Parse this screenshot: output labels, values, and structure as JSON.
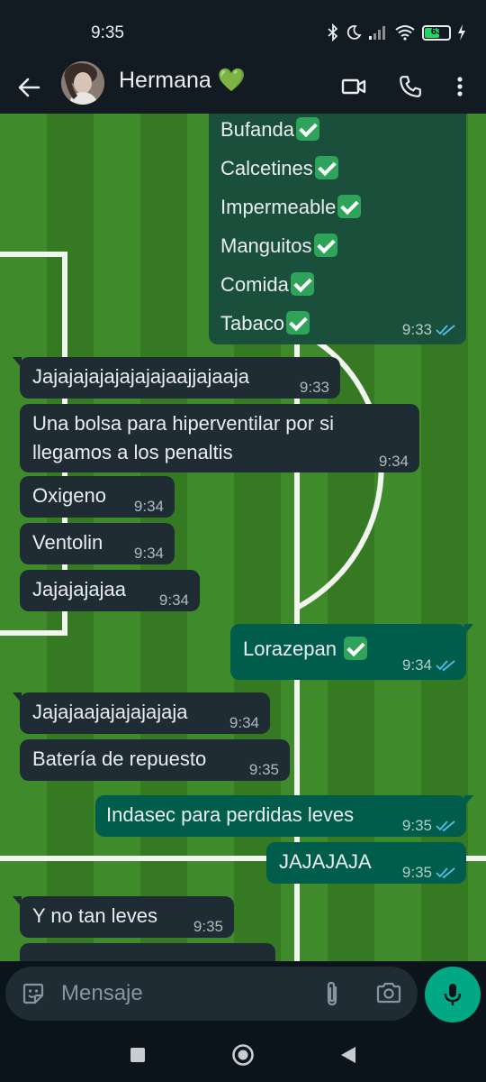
{
  "status_bar": {
    "time": "9:35",
    "battery_level": "63",
    "battery_fraction": 0.63
  },
  "header": {
    "contact_name": "Hermana 💚"
  },
  "colors": {
    "incoming_bubble": "#202c33",
    "outgoing_bubble": "#005c4b",
    "accent": "#00a884",
    "read_ticks": "#53bdeb"
  },
  "top_list": {
    "items": [
      "Bufanda",
      "Calcetines",
      "Impermeable",
      "Manguitos",
      "Comida",
      "Tabaco"
    ],
    "time": "9:33"
  },
  "messages": [
    {
      "dir": "in",
      "text": "Jajajajajajajajajaajjajaaja",
      "time": "9:33"
    },
    {
      "dir": "in",
      "text": "Una bolsa para hiperventilar por si\nllegamos a los penaltis",
      "time": "9:34"
    },
    {
      "dir": "in",
      "text": "Oxigeno",
      "time": "9:34"
    },
    {
      "dir": "in",
      "text": "Ventolin",
      "time": "9:34"
    },
    {
      "dir": "in",
      "text": "Jajajajajaa",
      "time": "9:34"
    },
    {
      "dir": "out",
      "text": "Lorazepan",
      "time": "9:34"
    },
    {
      "dir": "in",
      "text": "Jajajaajajajajajaja",
      "time": "9:34"
    },
    {
      "dir": "in",
      "text": "Batería de repuesto",
      "time": "9:35"
    },
    {
      "dir": "out",
      "text": "Indasec para perdidas leves",
      "time": "9:35"
    },
    {
      "dir": "out",
      "text": "JAJAJAJA",
      "time": "9:35"
    },
    {
      "dir": "in",
      "text": "Y no tan leves",
      "time": "9:35"
    }
  ],
  "composer": {
    "placeholder": "Mensaje"
  },
  "icons": {
    "back": "arrow-left-icon",
    "video": "video-call-icon",
    "call": "phone-icon",
    "menu": "more-vert-icon",
    "sticker": "sticker-icon",
    "attach": "paperclip-icon",
    "camera": "camera-icon",
    "mic": "mic-icon"
  }
}
